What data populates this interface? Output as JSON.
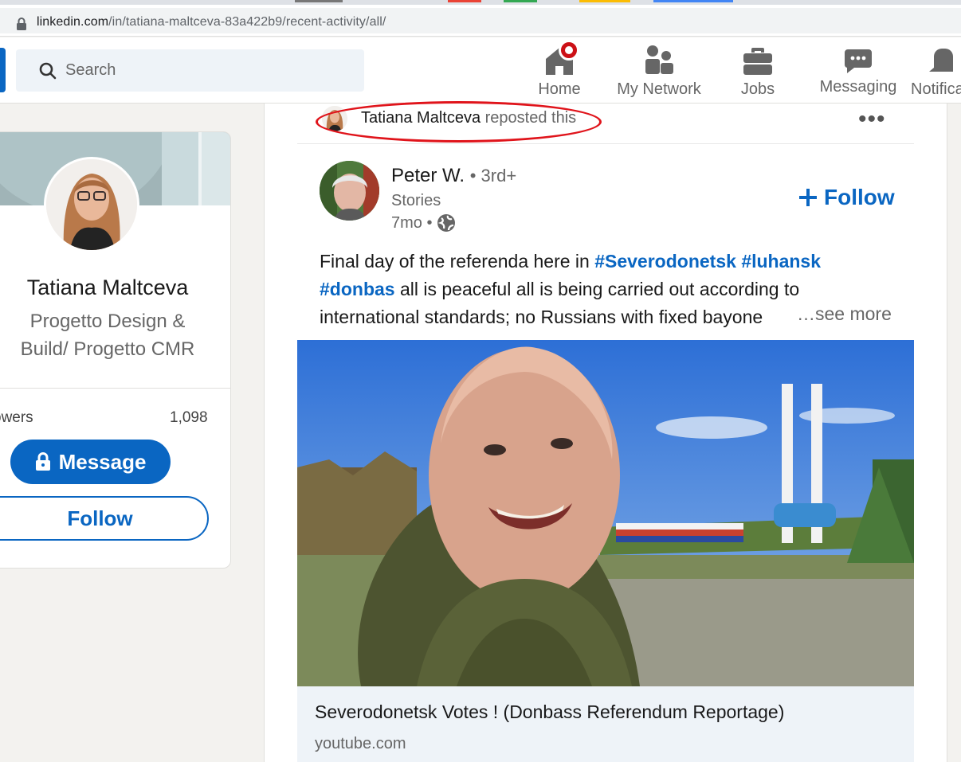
{
  "browser": {
    "url_domain": "linkedin.com",
    "url_path": "/in/tatiana-maltceva-83a422b9/recent-activity/all/"
  },
  "nav": {
    "search_placeholder": "Search",
    "items": [
      {
        "label": "Home",
        "icon": "home-icon"
      },
      {
        "label": "My Network",
        "icon": "people-icon"
      },
      {
        "label": "Jobs",
        "icon": "briefcase-icon"
      },
      {
        "label": "Messaging",
        "icon": "chat-icon"
      },
      {
        "label": "Notifica",
        "icon": "bell-icon"
      }
    ]
  },
  "profile": {
    "name": "Tatiana Maltceva",
    "headline_line1": "Progetto Design &",
    "headline_line2": "Build/ Progetto CMR",
    "followers_label": "owers",
    "followers_count": "1,098",
    "message_label": "Message",
    "follow_label": "Follow"
  },
  "post": {
    "reposter_name": "Tatiana Maltceva",
    "repost_verb": "reposted this",
    "author_name": "Peter W.",
    "author_degree": "• 3rd+",
    "author_headline": "Stories",
    "post_age": "7mo •",
    "follow_label": "Follow",
    "text_prefix": "Final day of the referenda here in ",
    "hashtag1": "#Severodonetsk",
    "hashtag2": "#luhansk",
    "hashtag3": "#donbas",
    "text_line2": " all is peaceful all is being carried out according to",
    "text_line3": "international standards; no Russians with fixed bayone",
    "see_more": "…see more",
    "link_title": "Severodonetsk Votes ! (Donbass Referendum Reportage)",
    "link_domain": "youtube.com"
  },
  "colors": {
    "linkedin_blue": "#0a66c2",
    "annotation_red": "#e0141b",
    "notification_red": "#cc1016"
  }
}
